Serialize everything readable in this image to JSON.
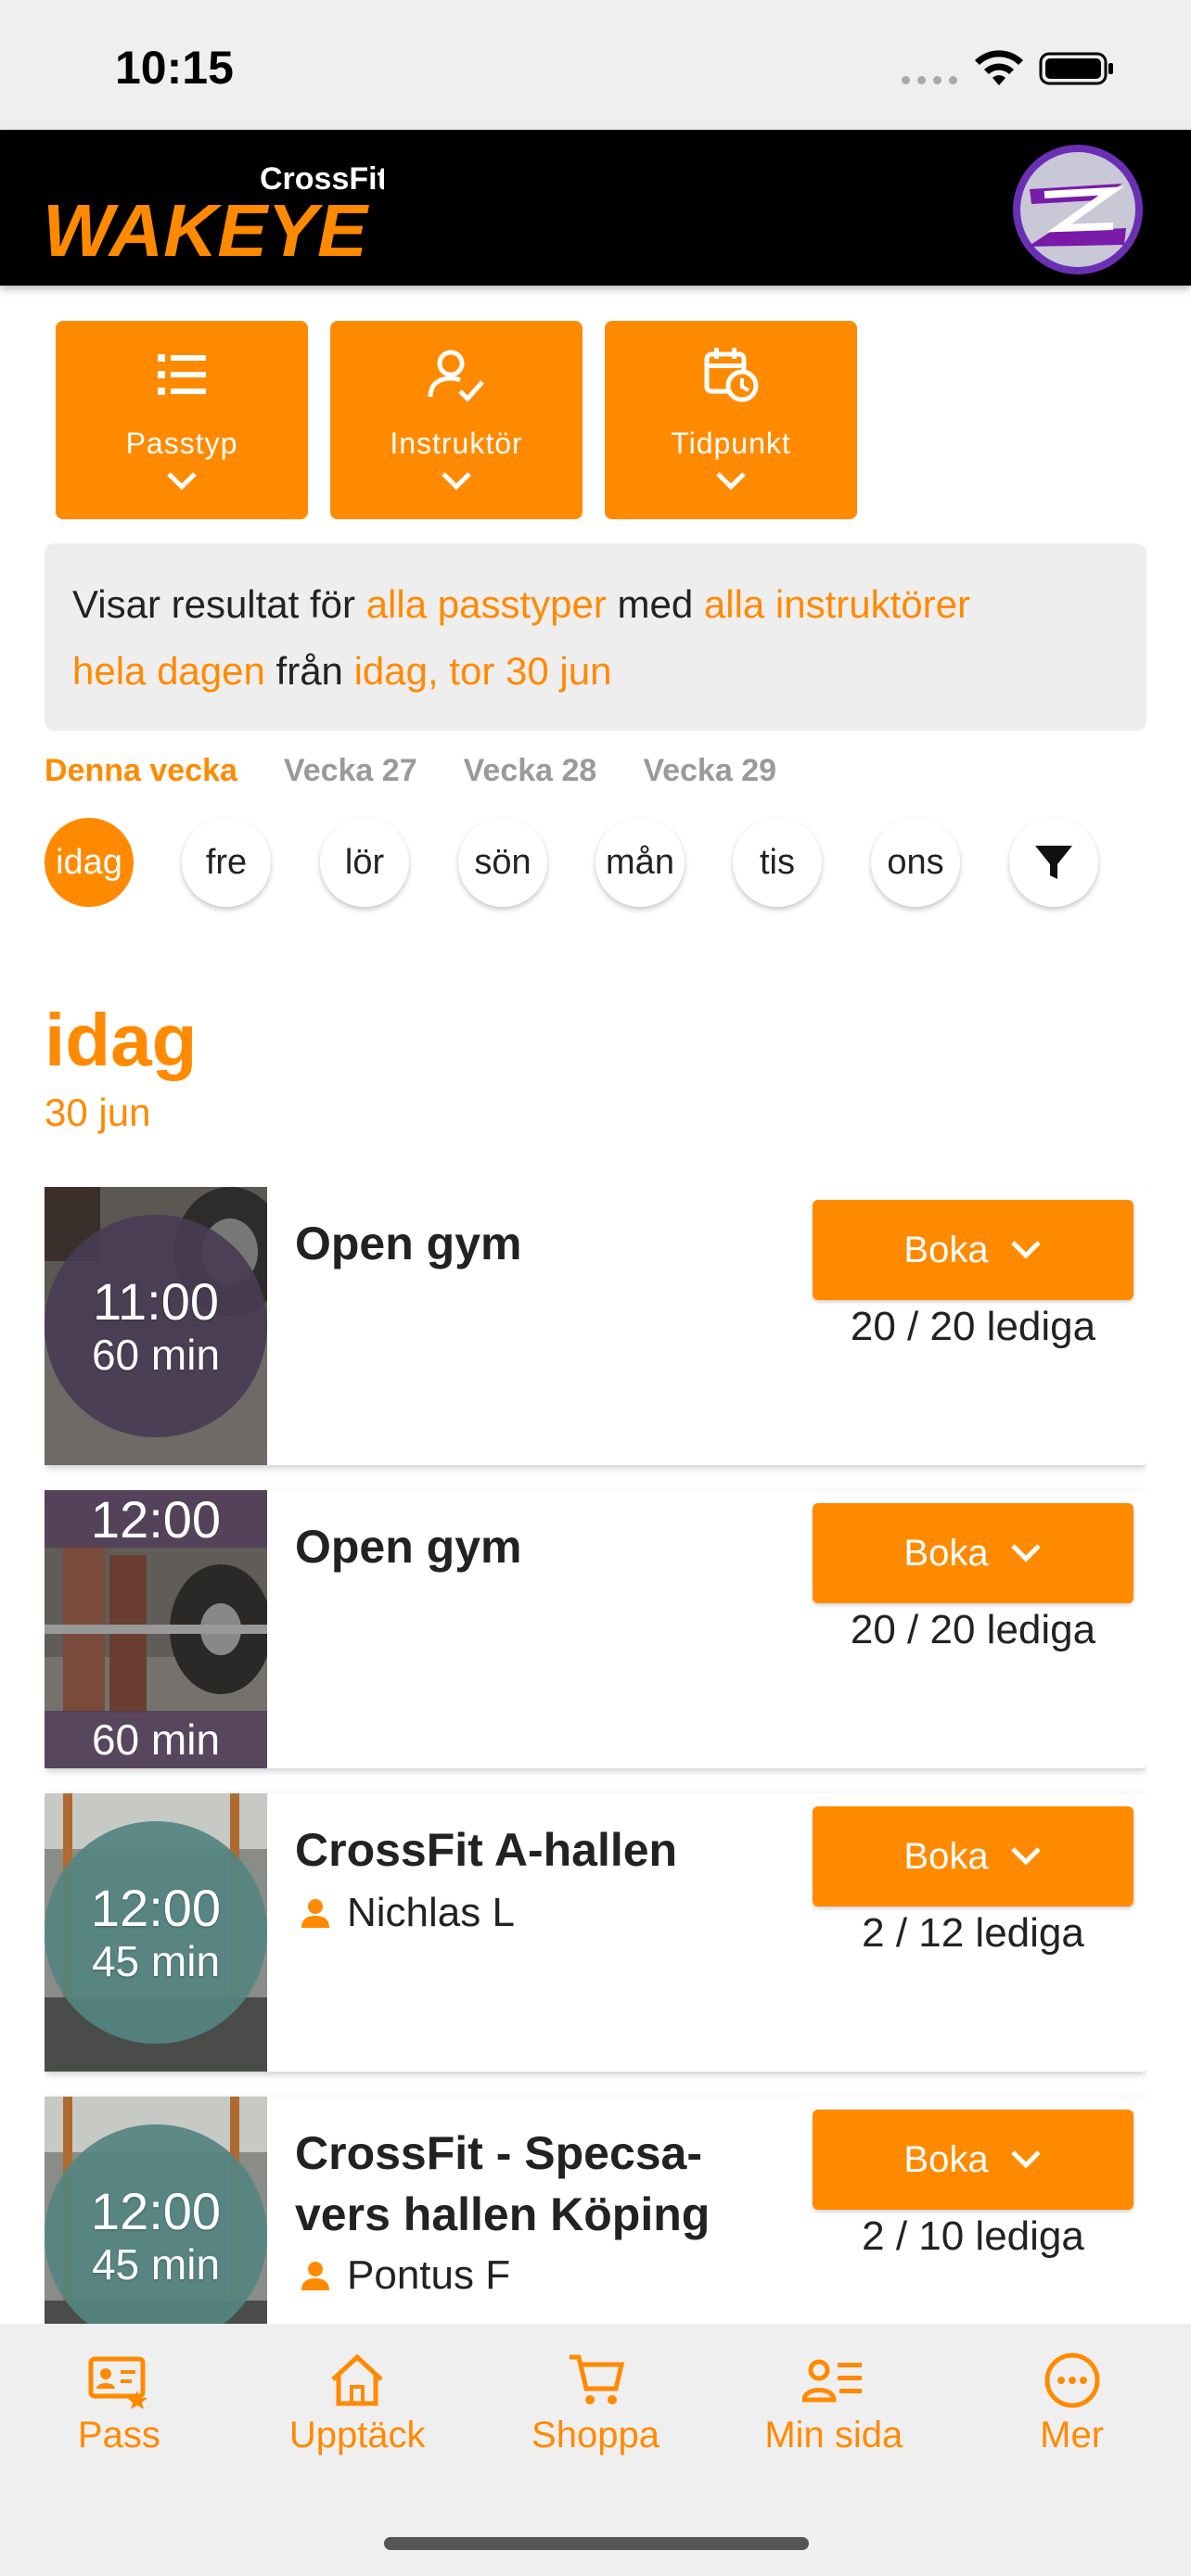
{
  "status_bar": {
    "time": "10:15"
  },
  "header": {
    "logo_small": "CrossFit",
    "logo_main": "WAKEYE"
  },
  "filters": [
    {
      "label": "Passtyp",
      "icon": "list-icon"
    },
    {
      "label": "Instruktör",
      "icon": "person-check-icon"
    },
    {
      "label": "Tidpunkt",
      "icon": "calendar-clock-icon"
    }
  ],
  "summary": {
    "p1": "Visar resultat för ",
    "h1": "alla passtyper",
    "p2": " med ",
    "h2": "alla instruktörer",
    "h3": "hela dagen",
    "p3": " från ",
    "h4": "idag, tor 30 jun"
  },
  "week_tabs": [
    "Denna vecka",
    "Vecka 27",
    "Vecka 28",
    "Vecka 29"
  ],
  "days": [
    "idag",
    "fre",
    "lör",
    "sön",
    "mån",
    "tis",
    "ons"
  ],
  "selected_day": {
    "heading": "idag",
    "date": "30 jun"
  },
  "classes": [
    {
      "time": "11:00",
      "duration": "60 min",
      "title": "Open gym",
      "instructor": "",
      "button": "Boka",
      "spots": "20 / 20 lediga"
    },
    {
      "time": "12:00",
      "duration": "60 min",
      "title": "Open gym",
      "instructor": "",
      "button": "Boka",
      "spots": "20 / 20 lediga"
    },
    {
      "time": "12:00",
      "duration": "45 min",
      "title": "CrossFit A-hallen",
      "instructor": "Nichlas L",
      "button": "Boka",
      "spots": "2 / 12 lediga"
    },
    {
      "time": "12:00",
      "duration": "45 min",
      "title": "CrossFit - Specsa-vers hallen Köping",
      "instructor": "Pontus F",
      "button": "Boka",
      "spots": "2 / 10 lediga"
    }
  ],
  "tabbar": [
    {
      "label": "Pass",
      "icon": "ticket-star-icon"
    },
    {
      "label": "Upptäck",
      "icon": "home-icon"
    },
    {
      "label": "Shoppa",
      "icon": "cart-icon"
    },
    {
      "label": "Min sida",
      "icon": "profile-list-icon"
    },
    {
      "label": "Mer",
      "icon": "more-dots-icon"
    }
  ],
  "colors": {
    "accent": "#ff8a00",
    "header_bg": "#000000",
    "panel_bg": "#eeeeee"
  }
}
